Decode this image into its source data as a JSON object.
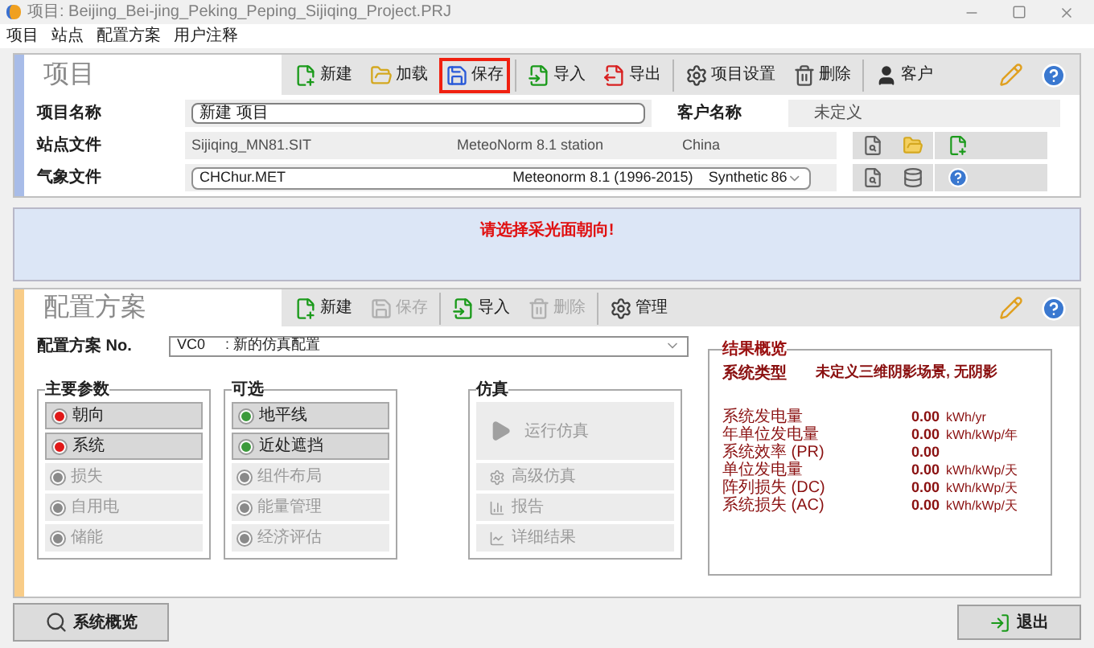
{
  "window": {
    "title": "项目: Beijing_Bei-jing_Peking_Peping_Sijiqing_Project.PRJ"
  },
  "menu": [
    "项目",
    "站点",
    "配置方案",
    "用户注释"
  ],
  "project": {
    "title": "项目",
    "toolbar": [
      {
        "kind": "new",
        "label": "新建",
        "disabled": false,
        "highlighted": false
      },
      {
        "kind": "load",
        "label": "加载",
        "disabled": false,
        "highlighted": false
      },
      {
        "kind": "save",
        "label": "保存",
        "disabled": false,
        "highlighted": true
      },
      {
        "kind": "import",
        "label": "导入",
        "disabled": false,
        "highlighted": false
      },
      {
        "kind": "export",
        "label": "导出",
        "disabled": false,
        "highlighted": false
      },
      {
        "kind": "settings",
        "label": "项目设置",
        "disabled": false,
        "highlighted": false
      },
      {
        "kind": "delete",
        "label": "删除",
        "disabled": false,
        "highlighted": false
      },
      {
        "kind": "client",
        "label": "客户",
        "disabled": false,
        "highlighted": false
      }
    ],
    "name_label": "项目名称",
    "name_value": "新建 项目",
    "client_label": "客户名称",
    "client_value": "未定义",
    "site_label": "站点文件",
    "site_file": "Sijiqing_MN81.SIT",
    "site_source": "MeteoNorm 8.1 station",
    "site_country": "China",
    "meteo_label": "气象文件",
    "meteo_file": "CHChur.MET",
    "meteo_source": "Meteonorm 8.1 (1996-2015)",
    "meteo_type": "Synthetic",
    "meteo_number": "86"
  },
  "message": "请选择采光面朝向!",
  "variant": {
    "title": "配置方案",
    "toolbar": [
      {
        "kind": "new",
        "label": "新建",
        "disabled": false,
        "highlighted": false
      },
      {
        "kind": "save",
        "label": "保存",
        "disabled": true,
        "highlighted": false
      },
      {
        "kind": "import",
        "label": "导入",
        "disabled": false,
        "highlighted": false
      },
      {
        "kind": "delete",
        "label": "删除",
        "disabled": true,
        "highlighted": false
      },
      {
        "kind": "settings",
        "label": "管理",
        "disabled": false,
        "highlighted": false
      }
    ],
    "no_label": "配置方案 No.",
    "no_value": "VC0     : 新的仿真配置"
  },
  "main_params": {
    "title": "主要参数",
    "items": [
      {
        "label": "朝向",
        "disabled": false,
        "color": "#e01818"
      },
      {
        "label": "系统",
        "disabled": false,
        "color": "#e01818"
      },
      {
        "label": "损失",
        "disabled": true,
        "color": "#8a8a8a"
      },
      {
        "label": "自用电",
        "disabled": true,
        "color": "#8a8a8a"
      },
      {
        "label": "储能",
        "disabled": true,
        "color": "#8a8a8a"
      }
    ]
  },
  "optional": {
    "title": "可选",
    "items": [
      {
        "label": "地平线",
        "disabled": false,
        "color": "#3c9a3c"
      },
      {
        "label": "近处遮挡",
        "disabled": false,
        "color": "#3c9a3c"
      },
      {
        "label": "组件布局",
        "disabled": true,
        "color": "#8a8a8a"
      },
      {
        "label": "能量管理",
        "disabled": true,
        "color": "#8a8a8a"
      },
      {
        "label": "经济评估",
        "disabled": true,
        "color": "#8a8a8a"
      }
    ]
  },
  "simulation": {
    "title": "仿真",
    "items": [
      {
        "kind": "run",
        "label": "运行仿真",
        "disabled": true
      },
      {
        "kind": "advanced",
        "label": "高级仿真",
        "disabled": true
      },
      {
        "kind": "report",
        "label": "报告",
        "disabled": true
      },
      {
        "kind": "results",
        "label": "详细结果",
        "disabled": true
      }
    ]
  },
  "results": {
    "title": "结果概览",
    "type_label": "系统类型",
    "type_value": "未定义三维阴影场景, 无阴影",
    "rows": [
      {
        "label": "系统发电量",
        "value": "0.00",
        "unit": "kWh/yr"
      },
      {
        "label": "年单位发电量",
        "value": "0.00",
        "unit": "kWh/kWp/年"
      },
      {
        "label": "系统效率 (PR)",
        "value": "0.00",
        "unit": ""
      },
      {
        "label": "单位发电量",
        "value": "0.00",
        "unit": "kWh/kWp/天"
      },
      {
        "label": "阵列损失 (DC)",
        "value": "0.00",
        "unit": "kWh/kWp/天"
      },
      {
        "label": "系统损失 (AC)",
        "value": "0.00",
        "unit": "kWh/kWp/天"
      }
    ]
  },
  "footer": {
    "overview": "系统概览",
    "exit": "退出"
  }
}
